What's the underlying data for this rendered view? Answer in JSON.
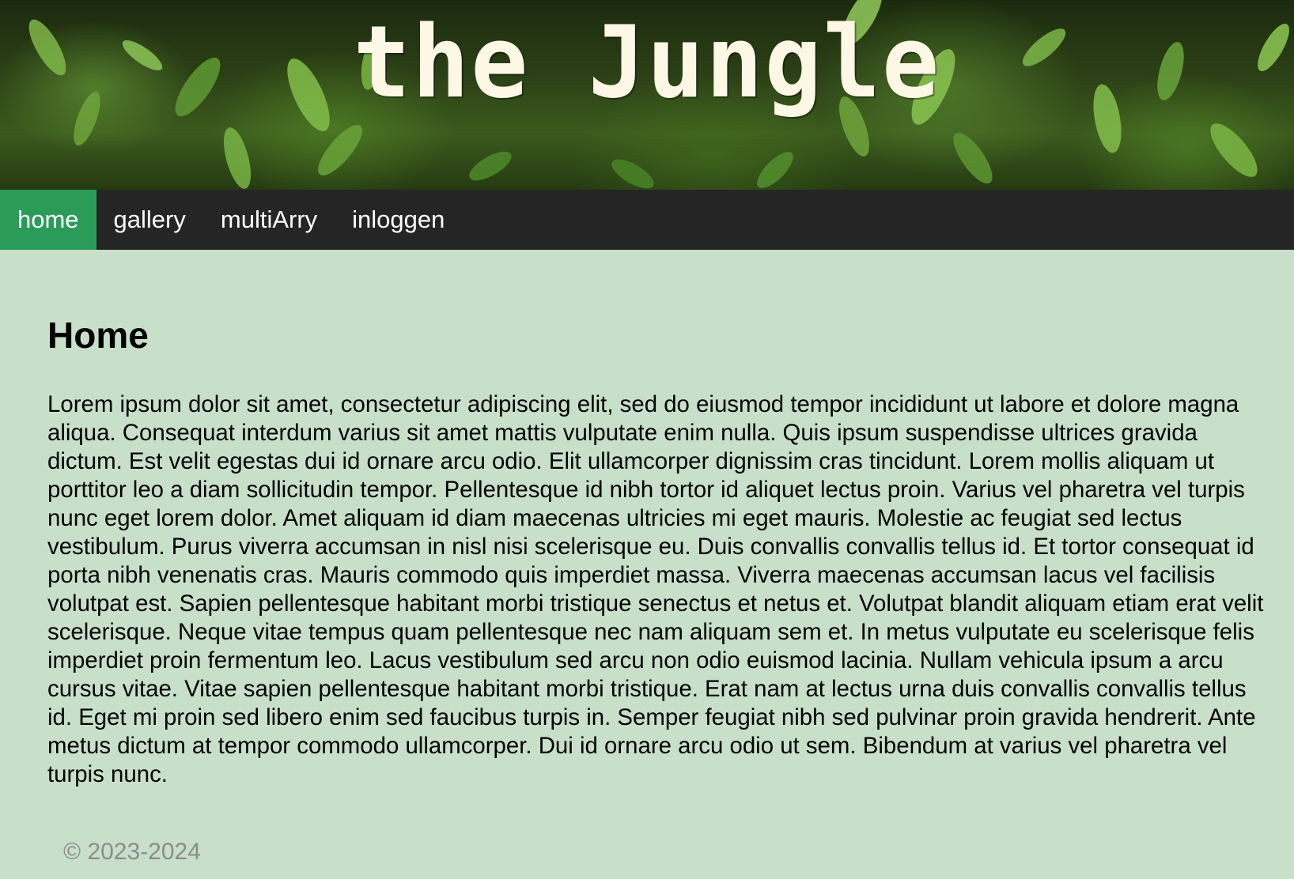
{
  "header": {
    "logo_text": "the Jungle"
  },
  "nav": {
    "items": [
      {
        "label": "home",
        "active": true
      },
      {
        "label": "gallery",
        "active": false
      },
      {
        "label": "multiArry",
        "active": false
      },
      {
        "label": "inloggen",
        "active": false
      }
    ]
  },
  "main": {
    "title": "Home",
    "body": "Lorem ipsum dolor sit amet, consectetur adipiscing elit, sed do eiusmod tempor incididunt ut labore et dolore magna aliqua. Consequat interdum varius sit amet mattis vulputate enim nulla. Quis ipsum suspendisse ultrices gravida dictum. Est velit egestas dui id ornare arcu odio. Elit ullamcorper dignissim cras tincidunt. Lorem mollis aliquam ut porttitor leo a diam sollicitudin tempor. Pellentesque id nibh tortor id aliquet lectus proin. Varius vel pharetra vel turpis nunc eget lorem dolor. Amet aliquam id diam maecenas ultricies mi eget mauris. Molestie ac feugiat sed lectus vestibulum. Purus viverra accumsan in nisl nisi scelerisque eu. Duis convallis convallis tellus id. Et tortor consequat id porta nibh venenatis cras. Mauris commodo quis imperdiet massa. Viverra maecenas accumsan lacus vel facilisis volutpat est. Sapien pellentesque habitant morbi tristique senectus et netus et. Volutpat blandit aliquam etiam erat velit scelerisque. Neque vitae tempus quam pellentesque nec nam aliquam sem et. In metus vulputate eu scelerisque felis imperdiet proin fermentum leo. Lacus vestibulum sed arcu non odio euismod lacinia. Nullam vehicula ipsum a arcu cursus vitae. Vitae sapien pellentesque habitant morbi tristique. Erat nam at lectus urna duis convallis convallis tellus id. Eget mi proin sed libero enim sed faucibus turpis in. Semper feugiat nibh sed pulvinar proin gravida hendrerit. Ante metus dictum at tempor commodo ullamcorper. Dui id ornare arcu odio ut sem. Bibendum at varius vel pharetra vel turpis nunc."
  },
  "footer": {
    "copyright": "© 2023-2024"
  },
  "colors": {
    "page_background": "#c8e0c9",
    "nav_background": "#252525",
    "nav_active": "#2a9b59",
    "logo_text": "#fdf7e6",
    "footer_text": "#8c8c8c"
  },
  "icons": {
    "banner_image": "jungle-foliage-image"
  }
}
